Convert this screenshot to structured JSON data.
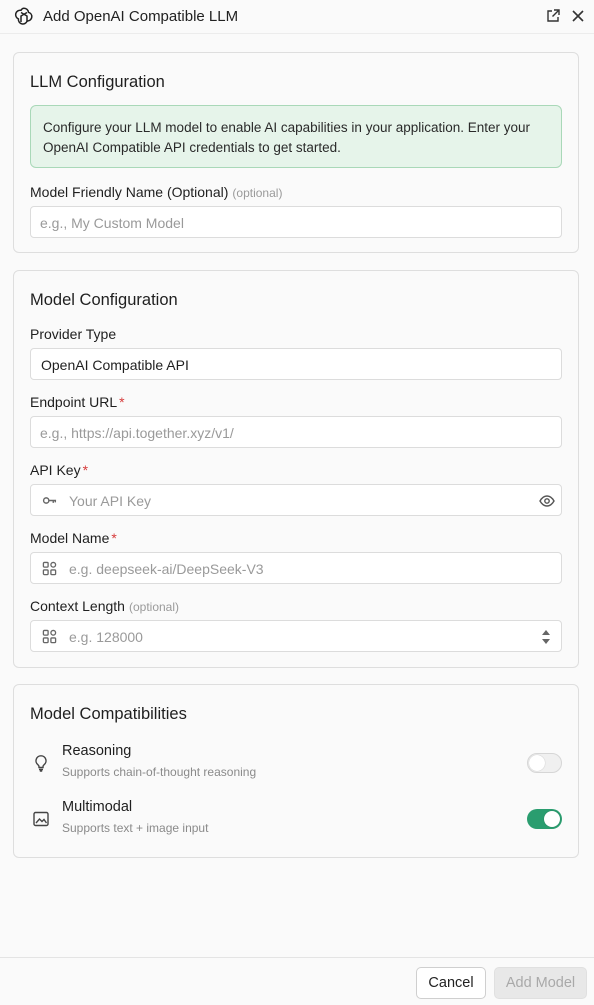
{
  "window": {
    "title": "Add OpenAI Compatible LLM",
    "logo_icon": "openai-logo-icon",
    "external_icon": "open-external-icon",
    "close_icon": "close-icon"
  },
  "llm_config": {
    "heading": "LLM Configuration",
    "info": "Configure your LLM model to enable AI capabilities in your application. Enter your OpenAI Compatible API credentials to get started.",
    "friendly_name": {
      "label": "Model Friendly Name (Optional)",
      "optional": "(optional)",
      "placeholder": "e.g., My Custom Model",
      "value": ""
    }
  },
  "model_config": {
    "heading": "Model Configuration",
    "provider_type": {
      "label": "Provider Type",
      "value": "OpenAI Compatible API"
    },
    "endpoint_url": {
      "label": "Endpoint URL",
      "required": "*",
      "placeholder": "e.g., https://api.together.xyz/v1/",
      "value": ""
    },
    "api_key": {
      "label": "API Key",
      "required": "*",
      "placeholder": "Your API Key",
      "value": "",
      "icon": "key-icon",
      "reveal_icon": "eye-icon"
    },
    "model_name": {
      "label": "Model Name",
      "required": "*",
      "placeholder": "e.g. deepseek-ai/DeepSeek-V3",
      "value": "",
      "icon": "grid-icon"
    },
    "context_length": {
      "label": "Context Length",
      "optional": "(optional)",
      "placeholder": "e.g. 128000",
      "value": "",
      "icon": "grid-icon",
      "stepper_icon": "stepper-arrows-icon"
    }
  },
  "capabilities": {
    "heading": "Model Compatibilities",
    "items": [
      {
        "title": "Reasoning",
        "subtitle": "Supports chain-of-thought reasoning",
        "icon": "lightbulb-icon",
        "enabled": false
      },
      {
        "title": "Multimodal",
        "subtitle": "Supports text + image input",
        "icon": "image-icon",
        "enabled": true
      }
    ]
  },
  "footer": {
    "cancel_label": "Cancel",
    "add_label": "Add Model"
  },
  "colors": {
    "accent": "#2a9d6f",
    "info_bg": "#e6f4ea",
    "required": "#d63b3b"
  }
}
